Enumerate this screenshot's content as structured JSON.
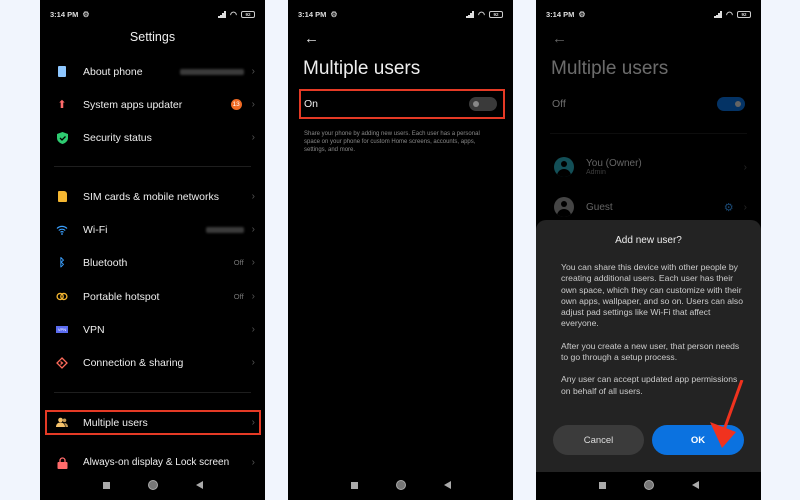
{
  "status_bar": {
    "time": "3:14 PM",
    "battery": "92"
  },
  "screen1": {
    "title": "Settings",
    "groups": [
      [
        {
          "label": "About phone",
          "icon": "phone-info-icon",
          "value_blurred": true,
          "color": "#8ec7ff"
        },
        {
          "label": "System apps updater",
          "icon": "arrow-up-icon",
          "badge": "13",
          "color": "#ff6b6b"
        },
        {
          "label": "Security status",
          "icon": "shield-check-icon",
          "color": "#2ecc71"
        }
      ],
      [
        {
          "label": "SIM cards & mobile networks",
          "icon": "sim-card-icon",
          "color": "#f5b731"
        },
        {
          "label": "Wi-Fi",
          "icon": "wifi-icon",
          "value_blurred": true,
          "color": "#3aa0ff"
        },
        {
          "label": "Bluetooth",
          "icon": "bluetooth-icon",
          "value": "Off",
          "color": "#3aa0ff"
        },
        {
          "label": "Portable hotspot",
          "icon": "hotspot-icon",
          "value": "Off",
          "color": "#f5b731"
        },
        {
          "label": "VPN",
          "icon": "vpn-icon",
          "color": "#5b6cf0"
        },
        {
          "label": "Connection & sharing",
          "icon": "connection-sharing-icon",
          "color": "#ff6b5b"
        }
      ],
      [
        {
          "label": "Multiple users",
          "icon": "users-icon",
          "highlighted": true,
          "color": "#f5c26b"
        },
        {
          "label": "Always-on display & Lock screen",
          "icon": "lock-icon",
          "color": "#ff6b6b"
        }
      ]
    ]
  },
  "screen2": {
    "title": "Multiple users",
    "toggle_label": "On",
    "toggle_state": false,
    "description": "Share your phone by adding new users. Each user has a personal space on your phone for custom Home screens, accounts, apps, settings, and more."
  },
  "screen3": {
    "title": "Multiple users",
    "toggle_label": "Off",
    "toggle_state": true,
    "users": [
      {
        "name": "You (Owner)",
        "sub": "Admin"
      },
      {
        "name": "Guest"
      }
    ],
    "dialog": {
      "title": "Add new user?",
      "paragraphs": [
        "You can share this device with other people by creating additional users. Each user has their own space, which they can customize with their own apps, wallpaper, and so on. Users can also adjust pad settings like Wi-Fi that affect everyone.",
        "After you create a new user, that person needs to go through a setup process.",
        "Any user can accept updated app permissions on behalf of all users."
      ],
      "cancel_label": "Cancel",
      "ok_label": "OK"
    }
  },
  "colors": {
    "highlight": "#e53a25",
    "accent_blue": "#0b72e0",
    "annotation_arrow": "#f0321e"
  }
}
